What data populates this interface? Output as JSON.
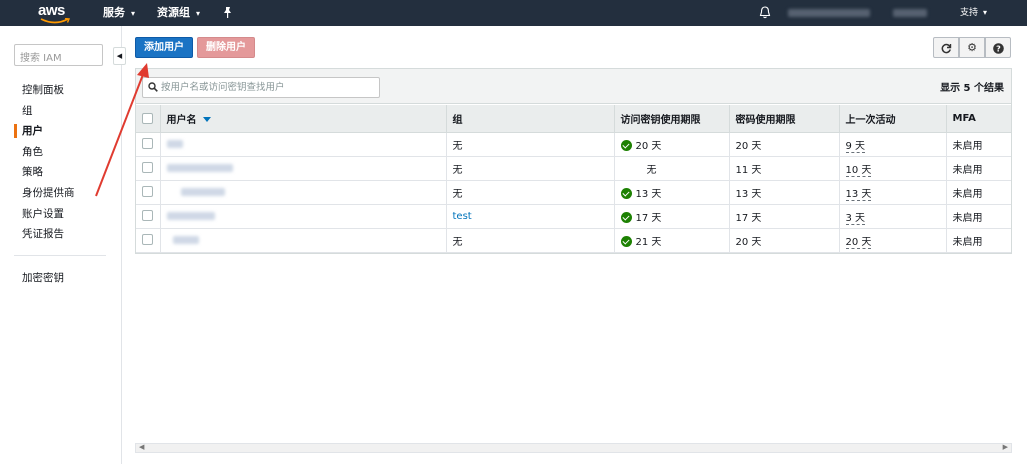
{
  "topnav": {
    "logo": "aws",
    "services_label": "服务",
    "resource_groups_label": "资源组",
    "support_label": "支持"
  },
  "sidebar": {
    "search_placeholder": "搜索 IAM",
    "items": [
      {
        "label": "控制面板"
      },
      {
        "label": "组"
      },
      {
        "label": "用户",
        "active": true
      },
      {
        "label": "角色"
      },
      {
        "label": "策略"
      },
      {
        "label": "身份提供商"
      },
      {
        "label": "账户设置"
      },
      {
        "label": "凭证报告"
      }
    ],
    "crypto_label": "加密密钥"
  },
  "toolbar": {
    "add_user_label": "添加用户",
    "delete_user_label": "删除用户"
  },
  "panel": {
    "filter_placeholder": "按用户名或访问密钥查找用户",
    "result_count": "显示 5 个结果"
  },
  "table": {
    "columns": [
      "用户名",
      "组",
      "访问密钥使用期限",
      "密码使用期限",
      "上一次活动",
      "MFA"
    ],
    "rows": [
      {
        "group": "无",
        "access_key_age": "20 天",
        "key_ok": true,
        "password_age": "20 天",
        "last_activity": "9 天",
        "mfa": "未启用"
      },
      {
        "group": "无",
        "access_key_age": "无",
        "key_ok": false,
        "password_age": "11 天",
        "last_activity": "10 天",
        "mfa": "未启用"
      },
      {
        "group": "无",
        "access_key_age": "13 天",
        "key_ok": true,
        "password_age": "13 天",
        "last_activity": "13 天",
        "mfa": "未启用"
      },
      {
        "group": "test",
        "access_key_age": "17 天",
        "key_ok": true,
        "password_age": "17 天",
        "last_activity": "3 天",
        "mfa": "未启用"
      },
      {
        "group": "无",
        "access_key_age": "21 天",
        "key_ok": true,
        "password_age": "20 天",
        "last_activity": "20 天",
        "mfa": "未启用"
      }
    ]
  },
  "colors": {
    "nav_bg": "#232f3e",
    "primary_button": "#1a73c4",
    "danger_button": "#e4999a",
    "active_indicator": "#ec7211",
    "status_ok": "#1d8102",
    "annotation_arrow": "#e03b30"
  }
}
